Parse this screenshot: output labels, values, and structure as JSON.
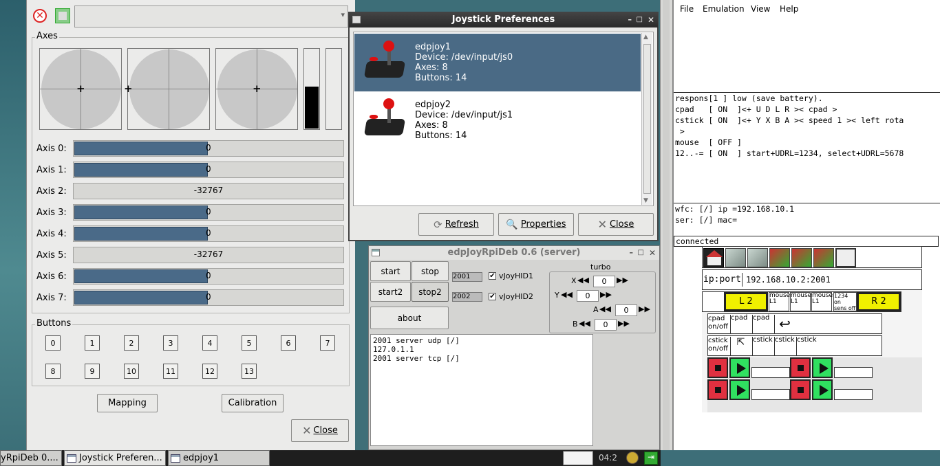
{
  "left_window": {
    "axes_label": "Axes",
    "axes": [
      {
        "label": "Axis 0:",
        "value": "0",
        "fill": 0.5
      },
      {
        "label": "Axis 1:",
        "value": "0",
        "fill": 0.5
      },
      {
        "label": "Axis 2:",
        "value": "-32767",
        "fill": 0
      },
      {
        "label": "Axis 3:",
        "value": "0",
        "fill": 0.5
      },
      {
        "label": "Axis 4:",
        "value": "0",
        "fill": 0.5
      },
      {
        "label": "Axis 5:",
        "value": "-32767",
        "fill": 0
      },
      {
        "label": "Axis 6:",
        "value": "0",
        "fill": 0.5
      },
      {
        "label": "Axis 7:",
        "value": "0",
        "fill": 0.5
      }
    ],
    "throttle_level": 0.52,
    "buttons_label": "Buttons",
    "buttons": [
      "0",
      "1",
      "2",
      "3",
      "4",
      "5",
      "6",
      "7",
      "8",
      "9",
      "10",
      "11",
      "12",
      "13"
    ],
    "mapping": "Mapping",
    "calibration": "Calibration",
    "close": "Close"
  },
  "prefs_window": {
    "title": "Joystick Preferences",
    "devices": [
      {
        "name": "edpjoy1",
        "device": "Device: /dev/input/js0",
        "axes": "Axes: 8",
        "buttons": "Buttons: 14"
      },
      {
        "name": "edpjoy2",
        "device": "Device: /dev/input/js1",
        "axes": "Axes: 8",
        "buttons": "Buttons: 14"
      }
    ],
    "refresh": "Refresh",
    "properties": "Properties",
    "close": "Close"
  },
  "server_window": {
    "title": "edpJoyRpiDeb 0.6 (server)",
    "start": "start",
    "stop": "stop",
    "start2": "start2",
    "stop2": "stop2",
    "about": "about",
    "port1": "2001",
    "port2": "2002",
    "check1": "vJoyHID1",
    "check2": "vJoyHID2",
    "turbo": "turbo",
    "x_label": "X",
    "y_label": "Y",
    "a_label": "A",
    "b_label": "B",
    "x_val": "0",
    "y_val": "0",
    "a_val": "0",
    "b_val": "0",
    "log": [
      "2001 server udp [/]",
      "127.0.1.1",
      "2001 server tcp [/]"
    ]
  },
  "emulator": {
    "menu": [
      "File",
      "Emulation",
      "View",
      "Help"
    ],
    "term_lines": [
      "respons[1 ] low (save battery).",
      "cpad   [ ON  ]<+ U D L R >< cpad >",
      "cstick [ ON  ]<+ Y X B A >< speed 1 >< left rota",
      " >",
      "mouse  [ OFF ]",
      "12..-= [ ON  ] start+UDRL=1234, select+UDRL=5678"
    ],
    "wfc": "wfc: [/] ip =192.168.10.1",
    "ser": "ser: [/] mac=",
    "status": "connected",
    "ipport_label": "ip:port",
    "ipport_value": "192.168.10.2:2001",
    "l2": "L 2",
    "r2": "R 2",
    "mouse_labels": [
      "mouse",
      "mouse",
      "mouse"
    ],
    "mouse_sub": [
      "L1",
      "L1",
      "L1"
    ],
    "sens_label": "1234 on",
    "sens_label2": "sens off",
    "cpad": [
      "cpad",
      "cpad",
      "cpad"
    ],
    "onoff": "on/off",
    "cstick": [
      "cstick",
      "cstick",
      "cstick",
      "cstick"
    ]
  },
  "taskbar": {
    "items": [
      "yRpiDeb 0....",
      "Joystick Preferen...",
      "edpjoy1"
    ],
    "clock": "04:2"
  }
}
